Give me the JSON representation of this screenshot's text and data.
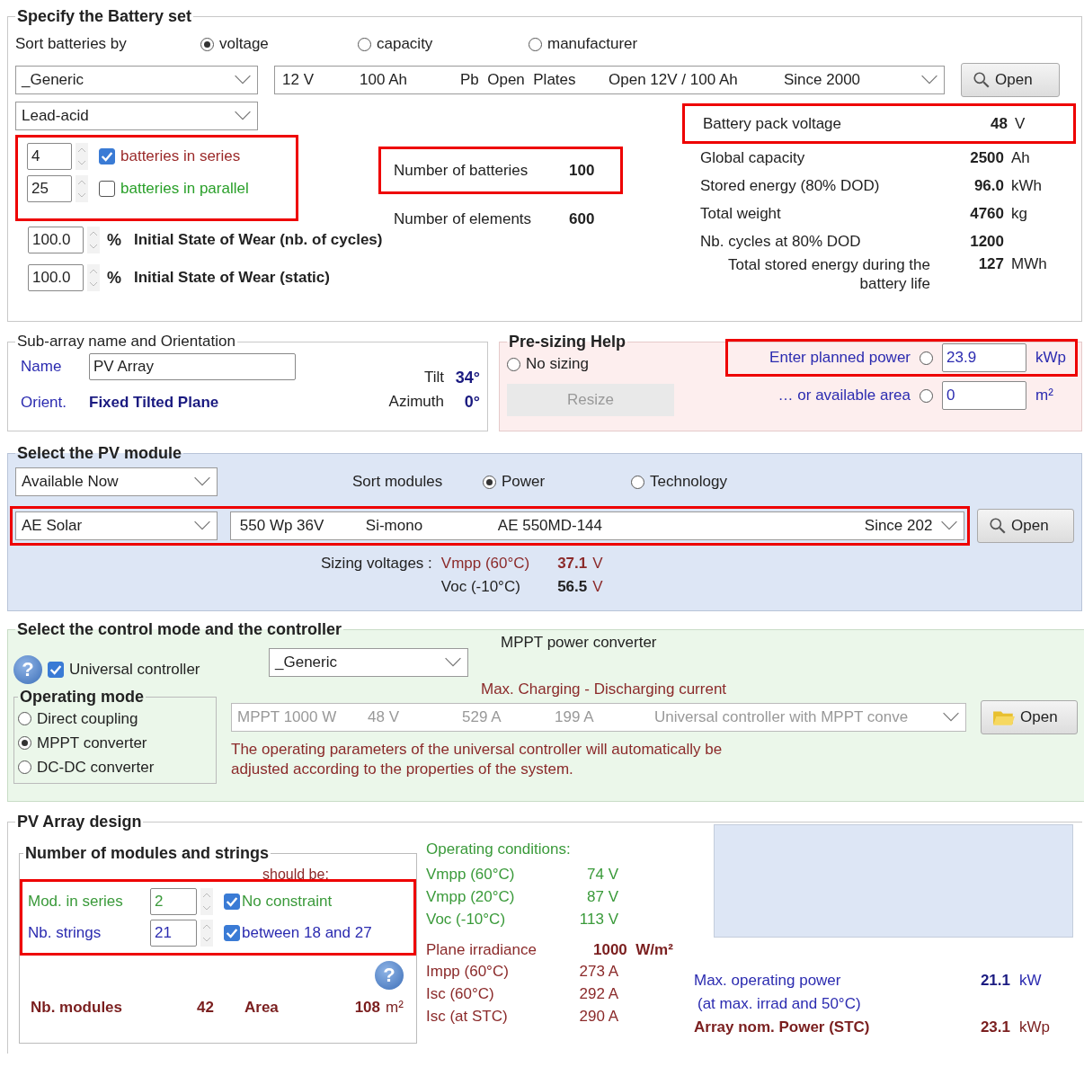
{
  "battery_set": {
    "title": "Specify the Battery set",
    "sort_label": "Sort batteries by",
    "sort_options": [
      {
        "label": "voltage",
        "selected": true
      },
      {
        "label": "capacity",
        "selected": false
      },
      {
        "label": "manufacturer",
        "selected": false
      }
    ],
    "manufacturer": "_Generic",
    "model_fields": [
      "12 V",
      "100 Ah",
      "Pb  Open  Plates",
      "Open 12V / 100 Ah",
      "Since 2000"
    ],
    "open_button": "Open",
    "technology": "Lead-acid",
    "series": {
      "value": "4",
      "label": "batteries in series",
      "checked": true
    },
    "parallel": {
      "value": "25",
      "label": "batteries in parallel",
      "checked": false
    },
    "nb_batteries": {
      "label": "Number of batteries",
      "value": "100"
    },
    "nb_elements": {
      "label": "Number of elements",
      "value": "600"
    },
    "wear": [
      {
        "value": "100.0",
        "unit": "%",
        "label": "Initial State of Wear (nb. of cycles)"
      },
      {
        "value": "100.0",
        "unit": "%",
        "label": "Initial State of Wear (static)"
      }
    ],
    "stats": [
      {
        "label": "Battery pack voltage",
        "value": "48",
        "unit": "V",
        "highlighted": true
      },
      {
        "label": "Global capacity",
        "value": "2500",
        "unit": "Ah",
        "highlighted": false
      },
      {
        "label": "Stored energy (80% DOD)",
        "value": "96.0",
        "unit": "kWh",
        "highlighted": false
      },
      {
        "label": "Total weight",
        "value": "4760",
        "unit": "kg",
        "highlighted": false
      },
      {
        "label": "Nb. cycles at 80% DOD",
        "value": "1200",
        "highlighted": false
      },
      {
        "label": "Total stored energy during the battery life",
        "value": "127",
        "unit": "MWh",
        "highlighted": false
      }
    ]
  },
  "sub_array": {
    "title": "Sub-array name and Orientation",
    "name_label": "Name",
    "name_value": "PV Array",
    "orient_label": "Orient.",
    "orient_value": "Fixed Tilted Plane",
    "tilt": {
      "label": "Tilt",
      "value": "34°"
    },
    "azimuth": {
      "label": "Azimuth",
      "value": "0°"
    }
  },
  "pre_sizing": {
    "title": "Pre-sizing Help",
    "no_sizing": {
      "label": "No sizing",
      "selected": false
    },
    "resize_button": {
      "label": "Resize",
      "disabled": true
    },
    "options": [
      {
        "label": "Enter planned power",
        "selected": false,
        "value": "23.9",
        "unit": "kWp",
        "highlighted": true
      },
      {
        "label": "… or available area",
        "selected": false,
        "value": "0",
        "unit": "m²",
        "highlighted": false
      }
    ]
  },
  "pv_module": {
    "title": "Select the PV module",
    "filter": "Available Now",
    "sort_label": "Sort modules",
    "sort_options": [
      {
        "label": "Power",
        "selected": true
      },
      {
        "label": "Technology",
        "selected": false
      }
    ],
    "manufacturer": "AE Solar",
    "model_fields": [
      "550 Wp 36V",
      "Si-mono",
      "AE 550MD-144",
      "Since 202"
    ],
    "open_button": "Open",
    "sizing_label": "Sizing voltages :",
    "sizing": [
      {
        "label": "Vmpp (60°C)",
        "value": "37.1",
        "unit": "V"
      },
      {
        "label": "Voc (-10°C)",
        "value": "56.5",
        "unit": "V"
      }
    ]
  },
  "controller": {
    "title": "Select the control mode and the controller",
    "help": "?",
    "universal": {
      "label": "Universal controller",
      "checked": true
    },
    "manufacturer": "_Generic",
    "converter_label": "MPPT power converter",
    "current_label": "Max. Charging - Discharging current",
    "operating_mode": {
      "title": "Operating mode",
      "options": [
        {
          "label": "Direct coupling",
          "selected": false
        },
        {
          "label": "MPPT converter",
          "selected": true
        },
        {
          "label": "DC-DC converter",
          "selected": false
        }
      ]
    },
    "fields": [
      "MPPT 1000 W",
      "48 V",
      "529 A",
      "199 A",
      "Universal controller with MPPT conve"
    ],
    "fields_disabled": true,
    "open_button": "Open",
    "note": "The operating parameters of the universal controller will automatically be adjusted according to the properties of the system."
  },
  "array_design": {
    "title": "PV Array design",
    "strings_title": "Number of modules and strings",
    "should_be": "should be:",
    "rows": [
      {
        "label": "Mod. in series",
        "value": "2",
        "check_label": "No constraint",
        "checked": true
      },
      {
        "label": "Nb. strings",
        "value": "21",
        "check_label": "between 18 and 27",
        "checked": true
      }
    ],
    "help": "?",
    "nb_modules": {
      "label": "Nb. modules",
      "value": "42"
    },
    "area": {
      "label": "Area",
      "value": "108",
      "unit": "m²"
    },
    "conditions_title": "Operating conditions:",
    "voltages": [
      {
        "label": "Vmpp (60°C)",
        "value": "74 V"
      },
      {
        "label": "Vmpp (20°C)",
        "value": "87 V"
      },
      {
        "label": "Voc (-10°C)",
        "value": "113 V"
      }
    ],
    "irradiance": {
      "label": "Plane irradiance",
      "value": "1000  W/m²"
    },
    "currents": [
      {
        "label": "Impp (60°C)",
        "value": "273 A"
      },
      {
        "label": "Isc (60°C)",
        "value": "292 A"
      },
      {
        "label": "Isc (at STC)",
        "value": "290 A"
      }
    ],
    "max_power": {
      "label": "Max. operating power",
      "note": "(at max. irrad and 50°C)",
      "value": "21.1",
      "unit": "kW"
    },
    "nom_power": {
      "label": "Array nom. Power (STC)",
      "value": "23.1",
      "unit": "kWp"
    }
  }
}
